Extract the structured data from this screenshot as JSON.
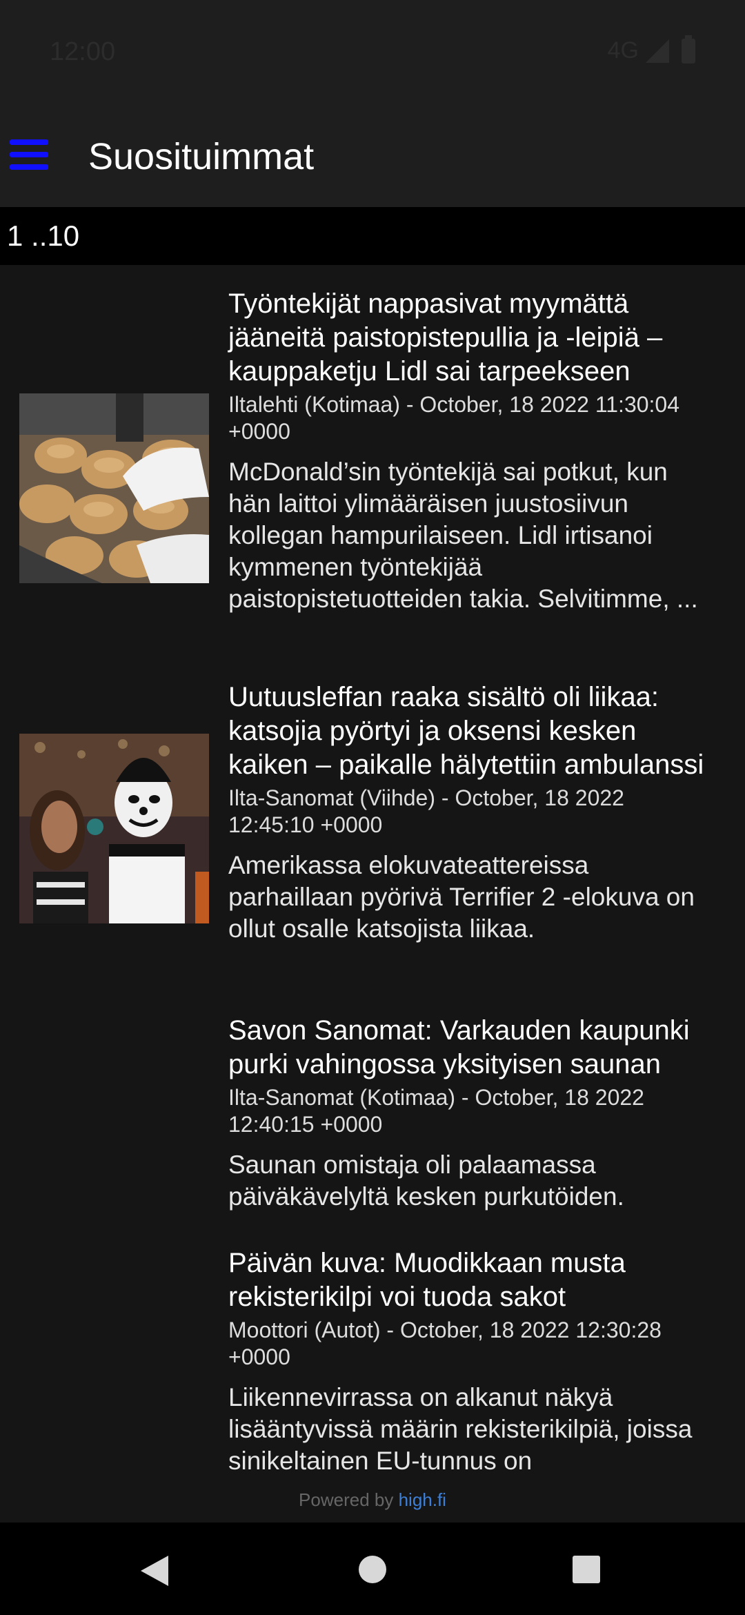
{
  "status_bar": {
    "time": "12:00",
    "network": "4G"
  },
  "app_bar": {
    "title": "Suosituimmat",
    "menu_icon": "hamburger-menu-icon",
    "accent": "#1010ff"
  },
  "range": {
    "label": "1 ..10"
  },
  "articles": [
    {
      "headline": "Työntekijät nappasivat myymättä jääneitä paistopistepullia ja -leipiä – kauppaketju Lidl sai tarpeekseen",
      "source": "Iltalehti (Kotimaa) - October, 18 2022 11:30:04 +0000",
      "summary": "McDonald’sin työntekijä sai potkut, kun hän laittoi ylimääräisen juustosiivun kollegan hampurilaiseen. Lidl irtisanoi kymmenen työntekijää paistopistetuotteiden takia. Selvitimme, ...",
      "image": "bread-buns-gloved-hand-photo"
    },
    {
      "headline": "Uutuusleffan raaka sisältö oli liikaa: katsojia pyörtyi ja oksensi kesken kaiken – paikalle hälytettiin ambulanssi",
      "source": "Ilta-Sanomat (Viihde) - October, 18 2022 12:45:10 +0000",
      "summary": "Amerikassa elokuvateattereissa parhaillaan pyörivä Terrifier 2 -elokuva on ollut osalle katsojista liikaa.",
      "image": "clown-and-woman-photo"
    },
    {
      "headline": "Savon Sanomat: Varkauden kaupunki purki vahingossa yksityisen saunan",
      "source": "Ilta-Sanomat (Kotimaa) - October, 18 2022 12:40:15 +0000",
      "summary": "Saunan omistaja oli palaamassa päiväkävelyltä kesken purkutöiden."
    },
    {
      "headline": "Päivän kuva: Muodikkaan musta rekisterikilpi voi tuoda sakot",
      "source": "Moottori (Autot) - October, 18 2022 12:30:28 +0000",
      "summary": "Liikennevirrassa on alkanut näkyä lisääntyvissä määrin rekisterikilpiä, joissa sinikeltainen EU-tunnus on"
    }
  ],
  "footer": {
    "powered_prefix": "Powered by",
    "powered_brand": "high.fi",
    "brand_color": "#3d7fd6"
  },
  "nav_bar": {
    "back_icon": "back-triangle-icon",
    "home_icon": "home-circle-icon",
    "recents_icon": "recents-square-icon"
  }
}
